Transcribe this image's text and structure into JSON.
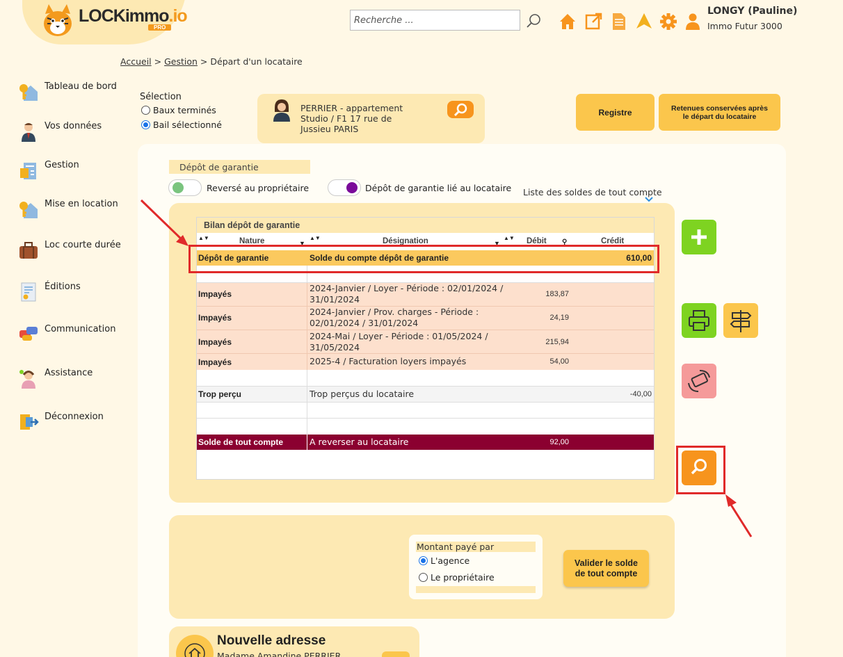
{
  "app": {
    "logo_main": "LOCKimmo",
    "logo_suffix": ".io",
    "logo_badge": "PRO"
  },
  "header": {
    "search_placeholder": "Recherche ...",
    "icons": [
      "home-icon",
      "external-link-icon",
      "document-icon",
      "arrow-up-icon",
      "gear-icon",
      "user-icon"
    ],
    "user_name": "LONGY (Pauline)",
    "user_company": "Immo Futur 3000"
  },
  "breadcrumb": {
    "items": [
      "Accueil",
      "Gestion"
    ],
    "current": "Départ d'un locataire",
    "separator": ">"
  },
  "sidebar": {
    "items": [
      {
        "label": "Tableau de bord",
        "icon": "keys-house-icon"
      },
      {
        "label": "Vos données",
        "icon": "person-icon"
      },
      {
        "label": "Gestion",
        "icon": "management-icon"
      },
      {
        "label": "Mise en location",
        "icon": "keys-house-icon"
      },
      {
        "label": "Loc courte durée",
        "icon": "suitcase-icon"
      },
      {
        "label": "Éditions",
        "icon": "report-icon"
      },
      {
        "label": "Communication",
        "icon": "chat-bubbles-icon"
      },
      {
        "label": "Assistance",
        "icon": "support-agent-icon"
      },
      {
        "label": "Déconnexion",
        "icon": "logout-icon"
      }
    ]
  },
  "selection": {
    "title": "Sélection",
    "options": [
      {
        "label": "Baux terminés",
        "selected": false
      },
      {
        "label": "Bail sélectionné",
        "selected": true
      }
    ]
  },
  "tenant": {
    "text": "PERRIER - appartement\nStudio / F1 17 rue de\nJussieu PARIS"
  },
  "top_buttons": {
    "registre": "Registre",
    "retenues": "Retenues conservées après le départ du locataire"
  },
  "deposit": {
    "section_label": "Dépôt de garantie",
    "toggle1_label": "Reversé au propriétaire",
    "toggle2_label": "Dépôt de garantie lié au locataire",
    "list_label": "Liste des soldes de tout compte"
  },
  "table": {
    "title": "Bilan dépôt de garantie",
    "headers": {
      "nature": "Nature",
      "designation": "Désignation",
      "debit": "Débit",
      "credit": "Crédit"
    },
    "rows": [
      {
        "nature": "Dépôt de garantie",
        "designation": "Solde du compte dépôt de garantie",
        "debit": "",
        "credit": "610,00"
      },
      {
        "nature": "Impayés",
        "designation": "2024-Janvier / Loyer - Période : 02/01/2024 / 31/01/2024",
        "debit": "183,87",
        "credit": ""
      },
      {
        "nature": "Impayés",
        "designation": "2024-Janvier / Prov. charges - Période : 02/01/2024 / 31/01/2024",
        "debit": "24,19",
        "credit": ""
      },
      {
        "nature": "Impayés",
        "designation": "2024-Mai / Loyer - Période : 01/05/2024 / 31/05/2024",
        "debit": "215,94",
        "credit": ""
      },
      {
        "nature": "Impayés",
        "designation": "2025-4 / Facturation loyers impayés",
        "debit": "54,00",
        "credit": ""
      },
      {
        "nature": "Trop perçu",
        "designation": "Trop perçus du locataire",
        "debit": "",
        "credit": "-40,00"
      },
      {
        "nature": "Solde de tout compte",
        "designation": "A reverser au locataire",
        "debit": "92,00",
        "credit": ""
      }
    ]
  },
  "side_actions": [
    "plus-icon",
    "printer-icon",
    "signpost-icon",
    "money-refund-icon",
    "search-icon"
  ],
  "payment": {
    "title": "Montant payé par",
    "options": [
      {
        "label": "L'agence",
        "selected": true
      },
      {
        "label": "Le propriétaire",
        "selected": false
      }
    ],
    "validate_label": "Valider le solde de tout compte"
  },
  "address": {
    "title": "Nouvelle adresse",
    "name": "Madame Amandine PERRIER"
  },
  "colors": {
    "accent_orange": "#f7941d",
    "panel_yellow": "#fde9b3",
    "button_yellow": "#fbc64c",
    "total_row": "#8b0030",
    "unpaid_row": "#fde0cd",
    "highlight_red": "#e02a2a",
    "add_green": "#7ed321"
  }
}
